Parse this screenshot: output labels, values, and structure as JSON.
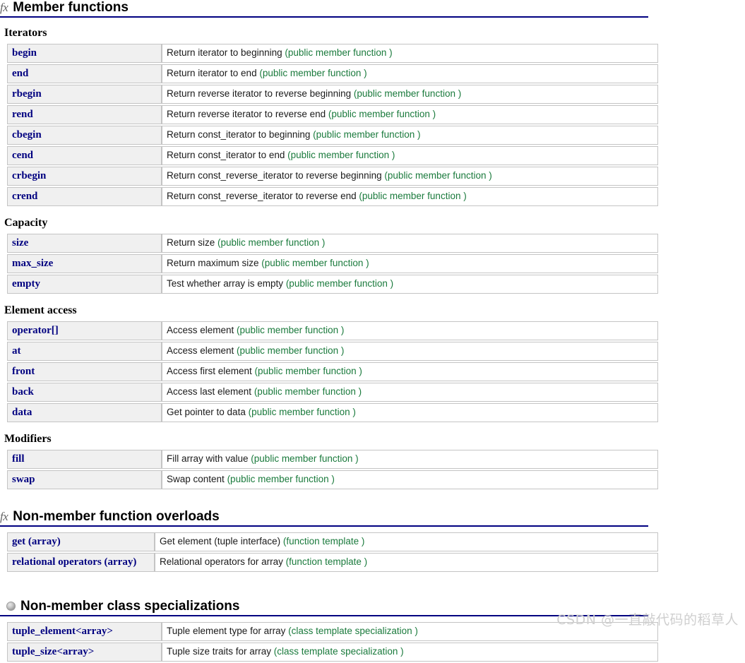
{
  "sections": [
    {
      "id": "member-functions",
      "icon": "fx-icon",
      "title": "Member functions",
      "groups": [
        {
          "heading": "Iterators",
          "rows": [
            {
              "name": "begin",
              "desc": "Return iterator to beginning ",
              "paren": "(public member function )"
            },
            {
              "name": "end",
              "desc": "Return iterator to end ",
              "paren": "(public member function )"
            },
            {
              "name": "rbegin",
              "desc": "Return reverse iterator to reverse beginning ",
              "paren": "(public member function )"
            },
            {
              "name": "rend",
              "desc": "Return reverse iterator to reverse end ",
              "paren": "(public member function )"
            },
            {
              "name": "cbegin",
              "desc": "Return const_iterator to beginning ",
              "paren": "(public member function )"
            },
            {
              "name": "cend",
              "desc": "Return const_iterator to end ",
              "paren": "(public member function )"
            },
            {
              "name": "crbegin",
              "desc": "Return const_reverse_iterator to reverse beginning ",
              "paren": "(public member function )"
            },
            {
              "name": "crend",
              "desc": "Return const_reverse_iterator to reverse end ",
              "paren": "(public member function )"
            }
          ]
        },
        {
          "heading": "Capacity",
          "rows": [
            {
              "name": "size",
              "desc": "Return size ",
              "paren": "(public member function )"
            },
            {
              "name": "max_size",
              "desc": "Return maximum size ",
              "paren": "(public member function )"
            },
            {
              "name": "empty",
              "desc": "Test whether array is empty ",
              "paren": "(public member function )"
            }
          ]
        },
        {
          "heading": "Element access",
          "rows": [
            {
              "name": "operator[]",
              "desc": "Access element ",
              "paren": "(public member function )"
            },
            {
              "name": "at",
              "desc": "Access element ",
              "paren": "(public member function )"
            },
            {
              "name": "front",
              "desc": "Access first element ",
              "paren": "(public member function )"
            },
            {
              "name": "back",
              "desc": "Access last element ",
              "paren": "(public member function )"
            },
            {
              "name": "data",
              "desc": "Get pointer to data ",
              "paren": "(public member function )"
            }
          ]
        },
        {
          "heading": "Modifiers",
          "rows": [
            {
              "name": "fill",
              "desc": "Fill array with value ",
              "paren": "(public member function )"
            },
            {
              "name": "swap",
              "desc": "Swap content ",
              "paren": "(public member function )"
            }
          ]
        }
      ]
    },
    {
      "id": "non-member-function-overloads",
      "icon": "fx-icon",
      "title": "Non-member function overloads",
      "groups": [
        {
          "heading": "",
          "rows": [
            {
              "name": "get (array)",
              "desc": "Get element (tuple interface) ",
              "paren": "(function template )"
            },
            {
              "name": "relational operators (array)",
              "desc": "Relational operators for array ",
              "paren": "(function template )"
            }
          ]
        }
      ]
    },
    {
      "id": "non-member-class-specializations",
      "icon": "ball-icon",
      "title": "Non-member class specializations",
      "groups": [
        {
          "heading": "",
          "rows": [
            {
              "name": "tuple_element<array>",
              "desc": "Tuple element type for array ",
              "paren": "(class template specialization )"
            },
            {
              "name": "tuple_size<array>",
              "desc": "Tuple size traits for array ",
              "paren": "(class template specialization )"
            }
          ]
        }
      ]
    }
  ],
  "watermark": "CSDN @一直敲代码的稻草人",
  "colors": {
    "link": "#000080",
    "paren": "#1a7a3c",
    "name_cell_bg": "#f0f0f0",
    "border": "#c4c4c4",
    "header_rule": "#000080",
    "watermark": "#cfcfcf"
  },
  "icons": {
    "fx": "fx"
  }
}
